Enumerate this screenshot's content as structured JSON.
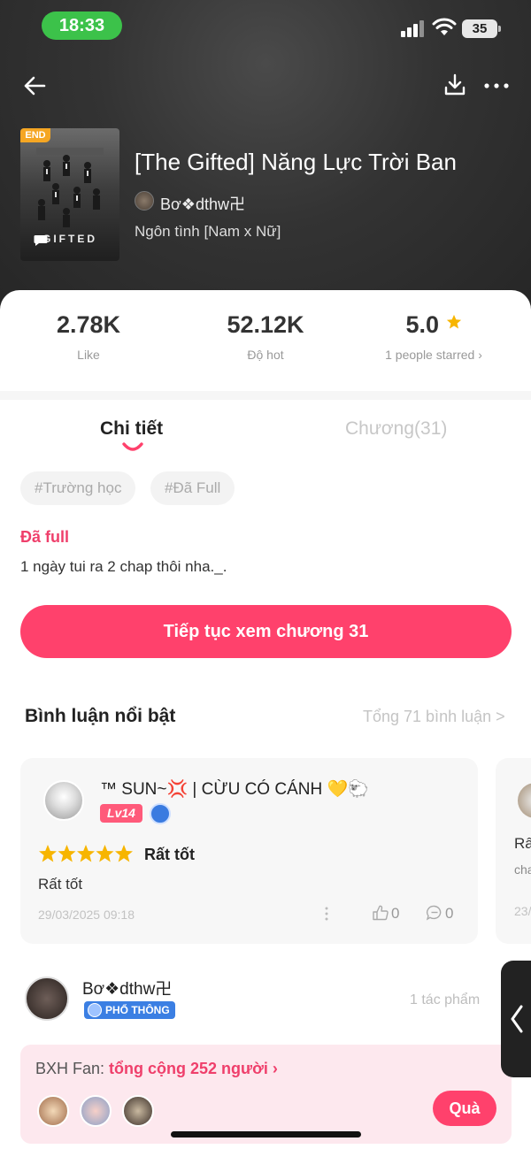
{
  "status_bar": {
    "time": "18:33",
    "battery": "35"
  },
  "book": {
    "badge": "END",
    "cover_title": "GIFTED",
    "title": "[The Gifted] Năng Lực Trời Ban",
    "author": "Bơ❖dthw卍",
    "genre": "Ngôn tình [Nam x Nữ]"
  },
  "stats": {
    "like_value": "2.78K",
    "like_label": "Like",
    "hot_value": "52.12K",
    "hot_label": "Độ hot",
    "rating_value": "5.0",
    "rating_label": "1 people starred ›"
  },
  "tabs": {
    "detail": "Chi tiết",
    "chapters": "Chương(31)"
  },
  "tags": [
    "#Trường học",
    "#Đã Full"
  ],
  "status_text": "Đã full",
  "description": "1 ngày tui ra 2 chap thôi nha._.",
  "cta_label": "Tiếp tục xem chương 31",
  "comments_section": {
    "title": "Bình luận nổi bật",
    "total_link": "Tổng 71 bình luận >"
  },
  "comment": {
    "name": "™ SUN~💢 | CỪU CÓ CÁNH 💛🐑",
    "level": "Lv14",
    "rating_text": "Rất tốt",
    "text": "Rất tốt",
    "date": "29/03/2025 09:18",
    "likes": "0",
    "replies": "0"
  },
  "comment_2": {
    "text1": "Rấ",
    "text2": "cha",
    "date": "23/"
  },
  "author_row": {
    "name": "Bơ❖dthw卍",
    "badge": "PHỔ THÔNG",
    "works": "1 tác phẩm"
  },
  "fan": {
    "label": "BXH Fan: ",
    "count": "tổng cộng 252 người ›",
    "gift_button": "Quà"
  },
  "colors": {
    "accent": "#ff416c",
    "status_green": "#3cc24a",
    "end_badge": "#f5a623"
  }
}
